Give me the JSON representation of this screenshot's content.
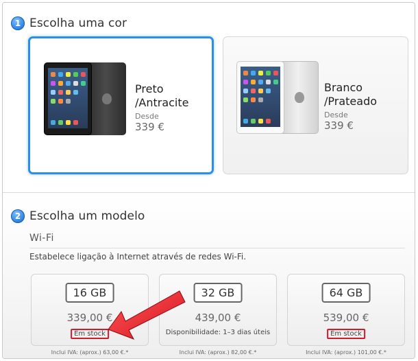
{
  "step1": {
    "number": "1",
    "title": "Escolha uma cor"
  },
  "colors": [
    {
      "name_line1": "Preto",
      "name_line2": "/Antracite",
      "desde": "Desde",
      "price": "339 €",
      "selected": true
    },
    {
      "name_line1": "Branco",
      "name_line2": "/Prateado",
      "desde": "Desde",
      "price": "339 €",
      "selected": false
    }
  ],
  "step2": {
    "number": "2",
    "title": "Escolha um modelo"
  },
  "connectivity": {
    "title": "Wi-Fi",
    "description": "Estabelece ligação à Internet através de redes Wi-Fi."
  },
  "models": [
    {
      "capacity": "16 GB",
      "price": "339,00 €",
      "availability": "Em stock",
      "highlighted": true,
      "vat": "Inclui IVA: (aprox.) 63,00 €.*"
    },
    {
      "capacity": "32 GB",
      "price": "439,00 €",
      "availability": "Disponibilidade:  1–3 dias úteis",
      "highlighted": false,
      "vat": "Inclui IVA: (aprox.) 82,00 €.*"
    },
    {
      "capacity": "64 GB",
      "price": "539,00 €",
      "availability": "Em stock",
      "highlighted": true,
      "vat": "Inclui IVA: (aprox.) 101,00 €.*"
    }
  ],
  "annotation": {
    "arrow_color": "#e8202b",
    "highlight_color": "#d4192c",
    "selection_color": "#2a8df0"
  }
}
